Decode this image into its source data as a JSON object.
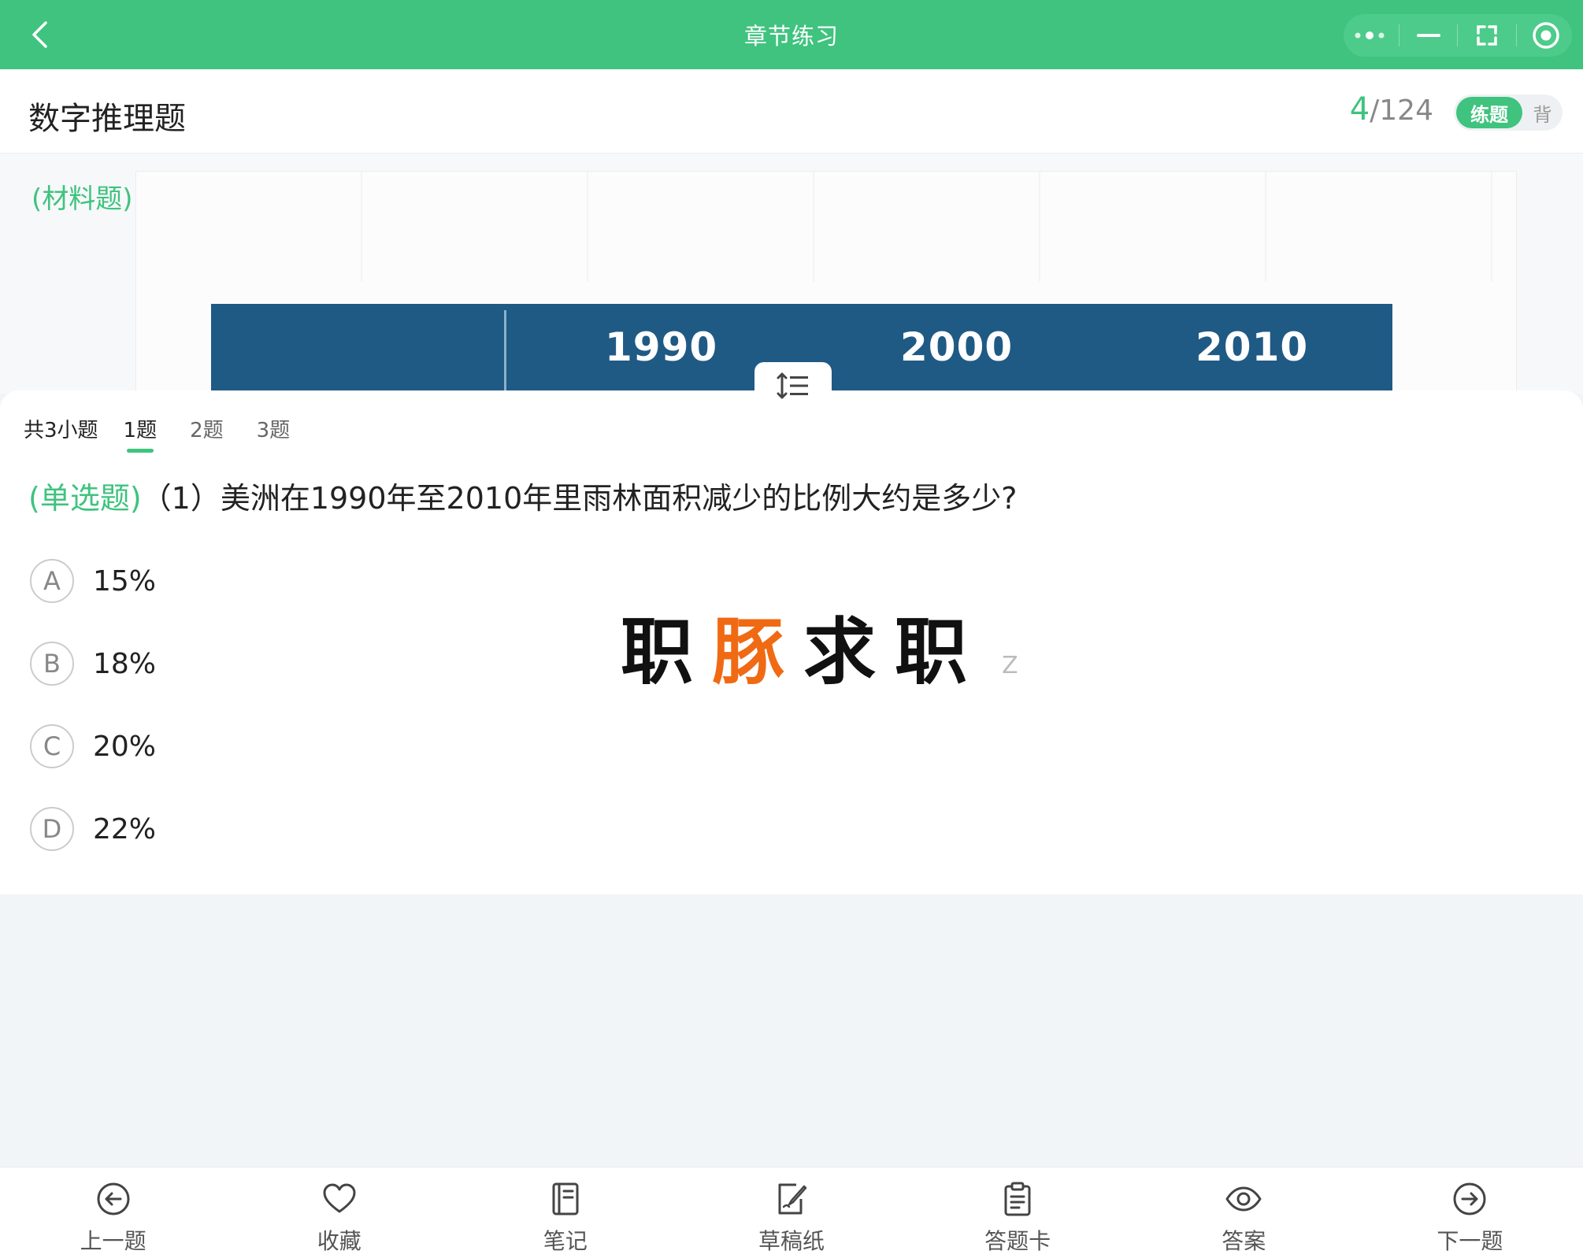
{
  "topbar": {
    "title": "章节练习",
    "background": "#3fc37e",
    "icons": [
      "back-icon",
      "more-icon",
      "minimize-icon",
      "restore-icon",
      "close-circle-icon"
    ]
  },
  "header": {
    "title": "数字推理题",
    "current": "4",
    "total": "124",
    "mode_active": "练题",
    "mode_inactive": "背"
  },
  "material": {
    "tag": "(材料题)",
    "table_years": [
      "1990",
      "2000",
      "2010"
    ]
  },
  "question": {
    "subcount_label": "共3小题",
    "subtabs": [
      "1题",
      "2题",
      "3题"
    ],
    "active_subtab": 0,
    "type": "(单选题)",
    "text": "（1）美洲在1990年至2010年里雨林面积减少的比例大约是多少?",
    "options": [
      {
        "letter": "A",
        "text": "15%"
      },
      {
        "letter": "B",
        "text": "18%"
      },
      {
        "letter": "C",
        "text": "20%"
      },
      {
        "letter": "D",
        "text": "22%"
      }
    ]
  },
  "watermark": {
    "chars": [
      "职",
      "豚",
      "求",
      "职"
    ],
    "z": "Z"
  },
  "bottom_nav": [
    {
      "label": "上一题",
      "icon": "prev-circle-icon"
    },
    {
      "label": "收藏",
      "icon": "heart-icon"
    },
    {
      "label": "笔记",
      "icon": "notebook-icon"
    },
    {
      "label": "草稿纸",
      "icon": "draft-paper-icon"
    },
    {
      "label": "答题卡",
      "icon": "clipboard-icon"
    },
    {
      "label": "答案",
      "icon": "eye-icon"
    },
    {
      "label": "下一题",
      "icon": "next-circle-icon"
    }
  ],
  "colors": {
    "accent": "#3fc37e",
    "table_header": "#1f5a85",
    "watermark_orange": "#f06a14"
  }
}
